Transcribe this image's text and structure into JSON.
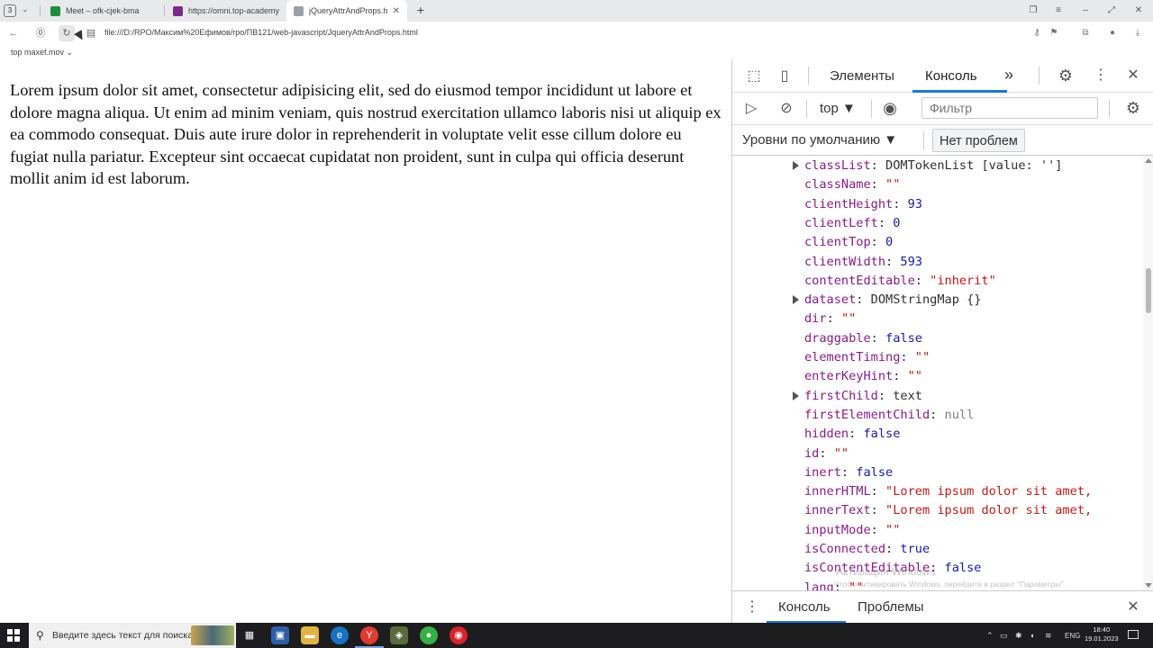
{
  "browser": {
    "tab_count": "3",
    "tabs": [
      {
        "title": "Meet – ofk-cjek-bma",
        "favicon_color": "#1e8e3e"
      },
      {
        "title": "https://omni.top-academy",
        "favicon_color": "#7b2a8c"
      },
      {
        "title": "jQueryAttrAndProps.htr",
        "favicon_color": "#9aa0a6",
        "active": true
      }
    ],
    "url": "file:///D:/RPO/Максим%20Ефимов/rpo/ПВ121/web-javascript/JqueryAttrAndProps.html",
    "frame_context": "top maxef.mov"
  },
  "page": {
    "paragraph": "Lorem ipsum dolor sit amet, consectetur adipisicing elit, sed do eiusmod tempor incididunt ut labore et dolore magna aliqua. Ut enim ad minim veniam, quis nostrud exercitation ullamco laboris nisi ut aliquip ex ea commodo consequat. Duis aute irure dolor in reprehenderit in voluptate velit esse cillum dolore eu fugiat nulla pariatur. Excepteur sint occaecat cupidatat non proident, sunt in culpa qui officia deserunt mollit anim id est laborum."
  },
  "devtools": {
    "tabs": {
      "elements": "Элементы",
      "console": "Консоль",
      "more": "»"
    },
    "context": "top",
    "filter_placeholder": "Фильтр",
    "levels": "Уровни по умолчанию",
    "no_issues": "Нет проблем",
    "properties": [
      {
        "key": "classList",
        "value": "DOMTokenList [value: '']",
        "type": "obj",
        "expandable": true
      },
      {
        "key": "className",
        "value": "\"\"",
        "type": "str"
      },
      {
        "key": "clientHeight",
        "value": "93",
        "type": "num"
      },
      {
        "key": "clientLeft",
        "value": "0",
        "type": "num"
      },
      {
        "key": "clientTop",
        "value": "0",
        "type": "num"
      },
      {
        "key": "clientWidth",
        "value": "593",
        "type": "num"
      },
      {
        "key": "contentEditable",
        "value": "\"inherit\"",
        "type": "str"
      },
      {
        "key": "dataset",
        "value": "DOMStringMap {}",
        "type": "obj",
        "expandable": true
      },
      {
        "key": "dir",
        "value": "\"\"",
        "type": "str"
      },
      {
        "key": "draggable",
        "value": "false",
        "type": "num"
      },
      {
        "key": "elementTiming",
        "value": "\"\"",
        "type": "str"
      },
      {
        "key": "enterKeyHint",
        "value": "\"\"",
        "type": "str"
      },
      {
        "key": "firstChild",
        "value": "text",
        "type": "obj",
        "expandable": true
      },
      {
        "key": "firstElementChild",
        "value": "null",
        "type": "null"
      },
      {
        "key": "hidden",
        "value": "false",
        "type": "num"
      },
      {
        "key": "id",
        "value": "\"\"",
        "type": "str"
      },
      {
        "key": "inert",
        "value": "false",
        "type": "num"
      },
      {
        "key": "innerHTML",
        "value": "\"Lorem ipsum dolor sit amet,",
        "type": "str"
      },
      {
        "key": "innerText",
        "value": "\"Lorem ipsum dolor sit amet,",
        "type": "str"
      },
      {
        "key": "inputMode",
        "value": "\"\"",
        "type": "str"
      },
      {
        "key": "isConnected",
        "value": "true",
        "type": "num"
      },
      {
        "key": "isContentEditable",
        "value": "false",
        "type": "num"
      },
      {
        "key": "lang",
        "value": "\"\"",
        "type": "str"
      }
    ],
    "watermark_title": "Активация Windows",
    "watermark_text": "Чтобы активировать Windows, перейдите в раздел \"Параметры\".",
    "drawer": {
      "console": "Консоль",
      "issues": "Проблемы"
    }
  },
  "taskbar": {
    "search_placeholder": "Введите здесь текст для поиска",
    "lang": "ENG",
    "time": "18:40",
    "date": "19.01.2023"
  }
}
